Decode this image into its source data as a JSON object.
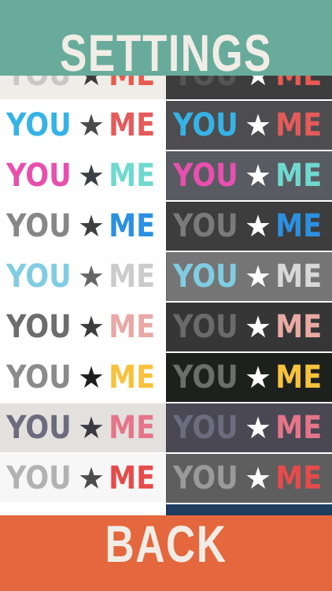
{
  "header": {
    "title": "SETTINGS",
    "background": "#68ab9b",
    "text_color": "#f1ede6"
  },
  "footer": {
    "back_label": "BACK",
    "background": "#e5673d",
    "text_color": "#f1ede6"
  },
  "labels": {
    "you": "YOU",
    "star": "★",
    "me": "ME"
  },
  "icons": {
    "star": "star-icon"
  },
  "themes": [
    {
      "light": {
        "bg": "#efede7",
        "you": "#c8c8c8",
        "star": "#3a3a3a",
        "me": "#e8594f"
      },
      "dark": {
        "bg": "#3d3d3d",
        "you": "#555555",
        "star": "#ffffff",
        "me": "#e8594f"
      }
    },
    {
      "light": {
        "bg": "#ffffff",
        "you": "#35b3e6",
        "star": "#4a4a4a",
        "me": "#e55a5a"
      },
      "dark": {
        "bg": "#4d4d4f",
        "you": "#35b3e6",
        "star": "#ffffff",
        "me": "#e55a5a"
      }
    },
    {
      "light": {
        "bg": "#ffffff",
        "you": "#e84fae",
        "star": "#3e3e46",
        "me": "#6fd9cf"
      },
      "dark": {
        "bg": "#595b62",
        "you": "#e84fae",
        "star": "#ffffff",
        "me": "#6fd9cf"
      }
    },
    {
      "light": {
        "bg": "#ffffff",
        "you": "#878787",
        "star": "#3f3f3f",
        "me": "#2b90e2"
      },
      "dark": {
        "bg": "#3d3d3d",
        "you": "#7a7a7a",
        "star": "#ffffff",
        "me": "#2b90e2"
      }
    },
    {
      "light": {
        "bg": "#ffffff",
        "you": "#80cde3",
        "star": "#676767",
        "me": "#cbcbcb"
      },
      "dark": {
        "bg": "#757575",
        "you": "#80cde3",
        "star": "#ffffff",
        "me": "#d8d8d8"
      }
    },
    {
      "light": {
        "bg": "#ffffff",
        "you": "#6d6d6d",
        "star": "#3c3c3c",
        "me": "#e8a9a6"
      },
      "dark": {
        "bg": "#363636",
        "you": "#6a6a6a",
        "star": "#ffffff",
        "me": "#eaaaa4"
      }
    },
    {
      "light": {
        "bg": "#ffffff",
        "you": "#8b8b8b",
        "star": "#1e1e1e",
        "me": "#f7c23b"
      },
      "dark": {
        "bg": "#1e201e",
        "you": "#6c6e6c",
        "star": "#ffffff",
        "me": "#f7c23b"
      }
    },
    {
      "light": {
        "bg": "#e3e1dd",
        "you": "#6d6b7e",
        "star": "#3a3942",
        "me": "#e67589"
      },
      "dark": {
        "bg": "#4a4852",
        "you": "#6d6b7e",
        "star": "#ffffff",
        "me": "#e67589"
      }
    },
    {
      "light": {
        "bg": "#f7f7f7",
        "you": "#b2b2b2",
        "star": "#4c4c4c",
        "me": "#e64b4b"
      },
      "dark": {
        "bg": "#5e5e5e",
        "you": "#9a9a9a",
        "star": "#ffffff",
        "me": "#e64b4b"
      }
    },
    {
      "light": {
        "bg": "#ffffff",
        "you": "#c9c9c9",
        "star": "#3f4758",
        "me": "#90bde4"
      },
      "dark": {
        "bg": "#1e3d5f",
        "you": "#c9cfd6",
        "star": "#ffffff",
        "me": "#90bde4"
      }
    }
  ]
}
